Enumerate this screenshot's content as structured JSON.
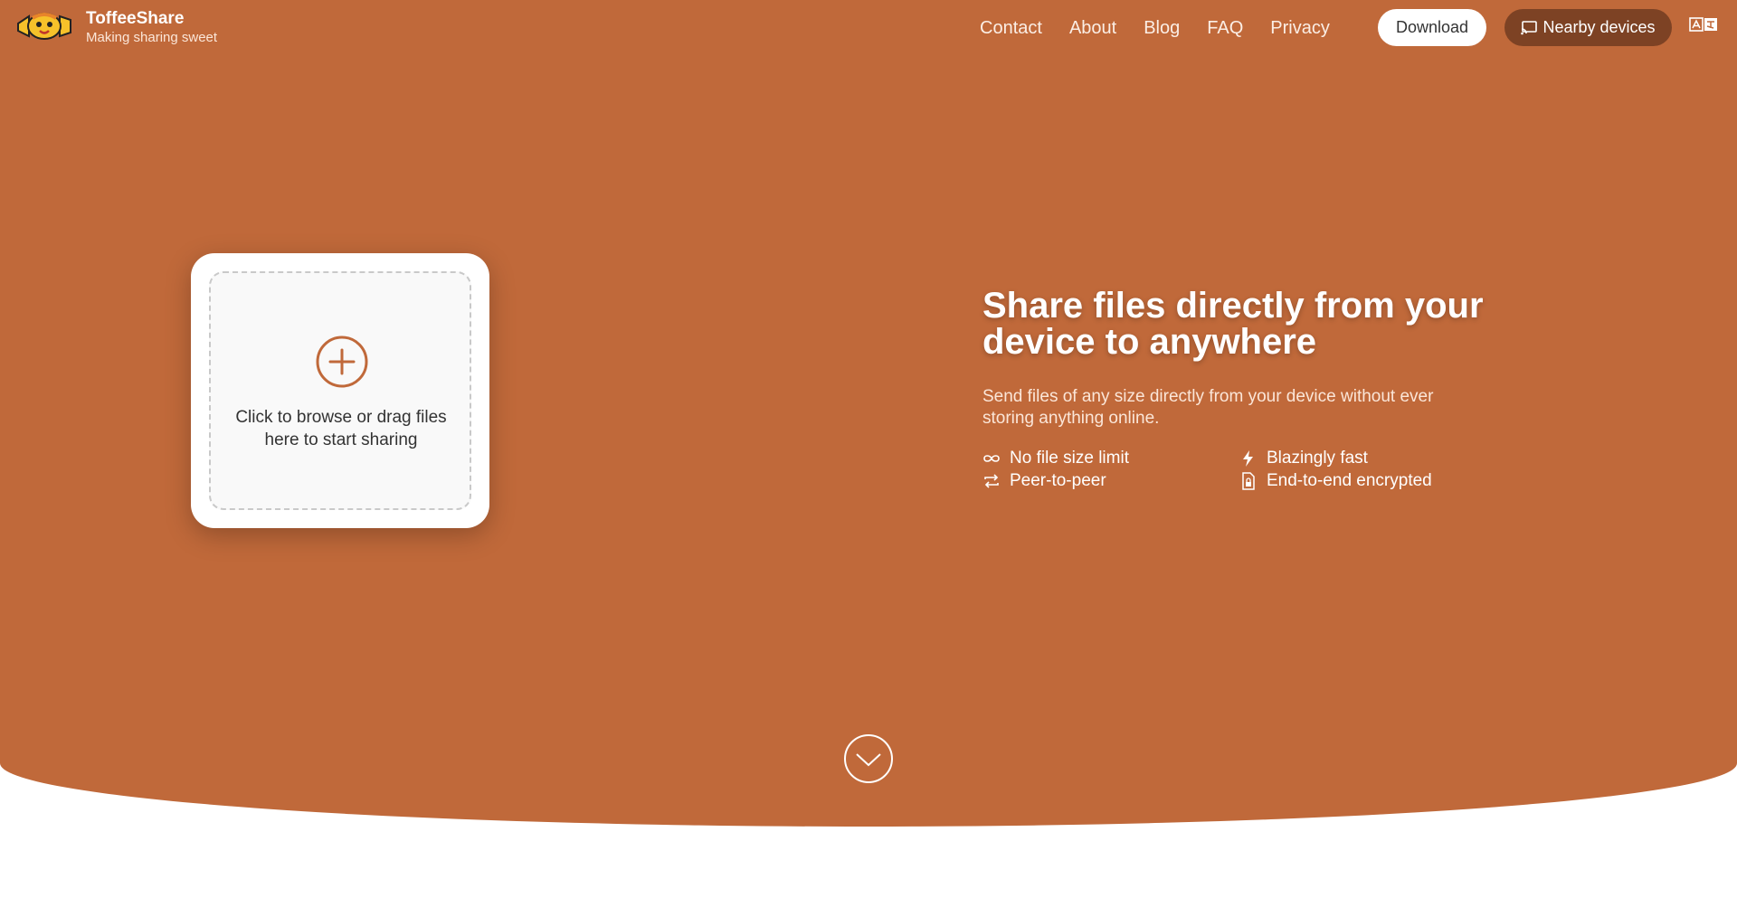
{
  "header": {
    "brand_name": "ToffeeShare",
    "brand_tagline": "Making sharing sweet",
    "nav": [
      "Contact",
      "About",
      "Blog",
      "FAQ",
      "Privacy"
    ],
    "download_label": "Download",
    "nearby_label": "Nearby devices"
  },
  "dropzone": {
    "text": "Click to browse or drag files here to start sharing"
  },
  "hero": {
    "headline": "Share files directly from your device to anywhere",
    "subtext": "Send files of any size directly from your device without ever storing anything online.",
    "features": [
      "No file size limit",
      "Blazingly fast",
      "Peer-to-peer",
      "End-to-end encrypted"
    ]
  },
  "colors": {
    "brand": "#c0693a",
    "nearby_button": "#7d4224"
  },
  "icons": [
    "candy-logo",
    "cast-icon",
    "translate-icon",
    "plus-circle-icon",
    "infinity-icon",
    "bolt-icon",
    "swap-icon",
    "lock-file-icon",
    "chevron-down-icon"
  ]
}
